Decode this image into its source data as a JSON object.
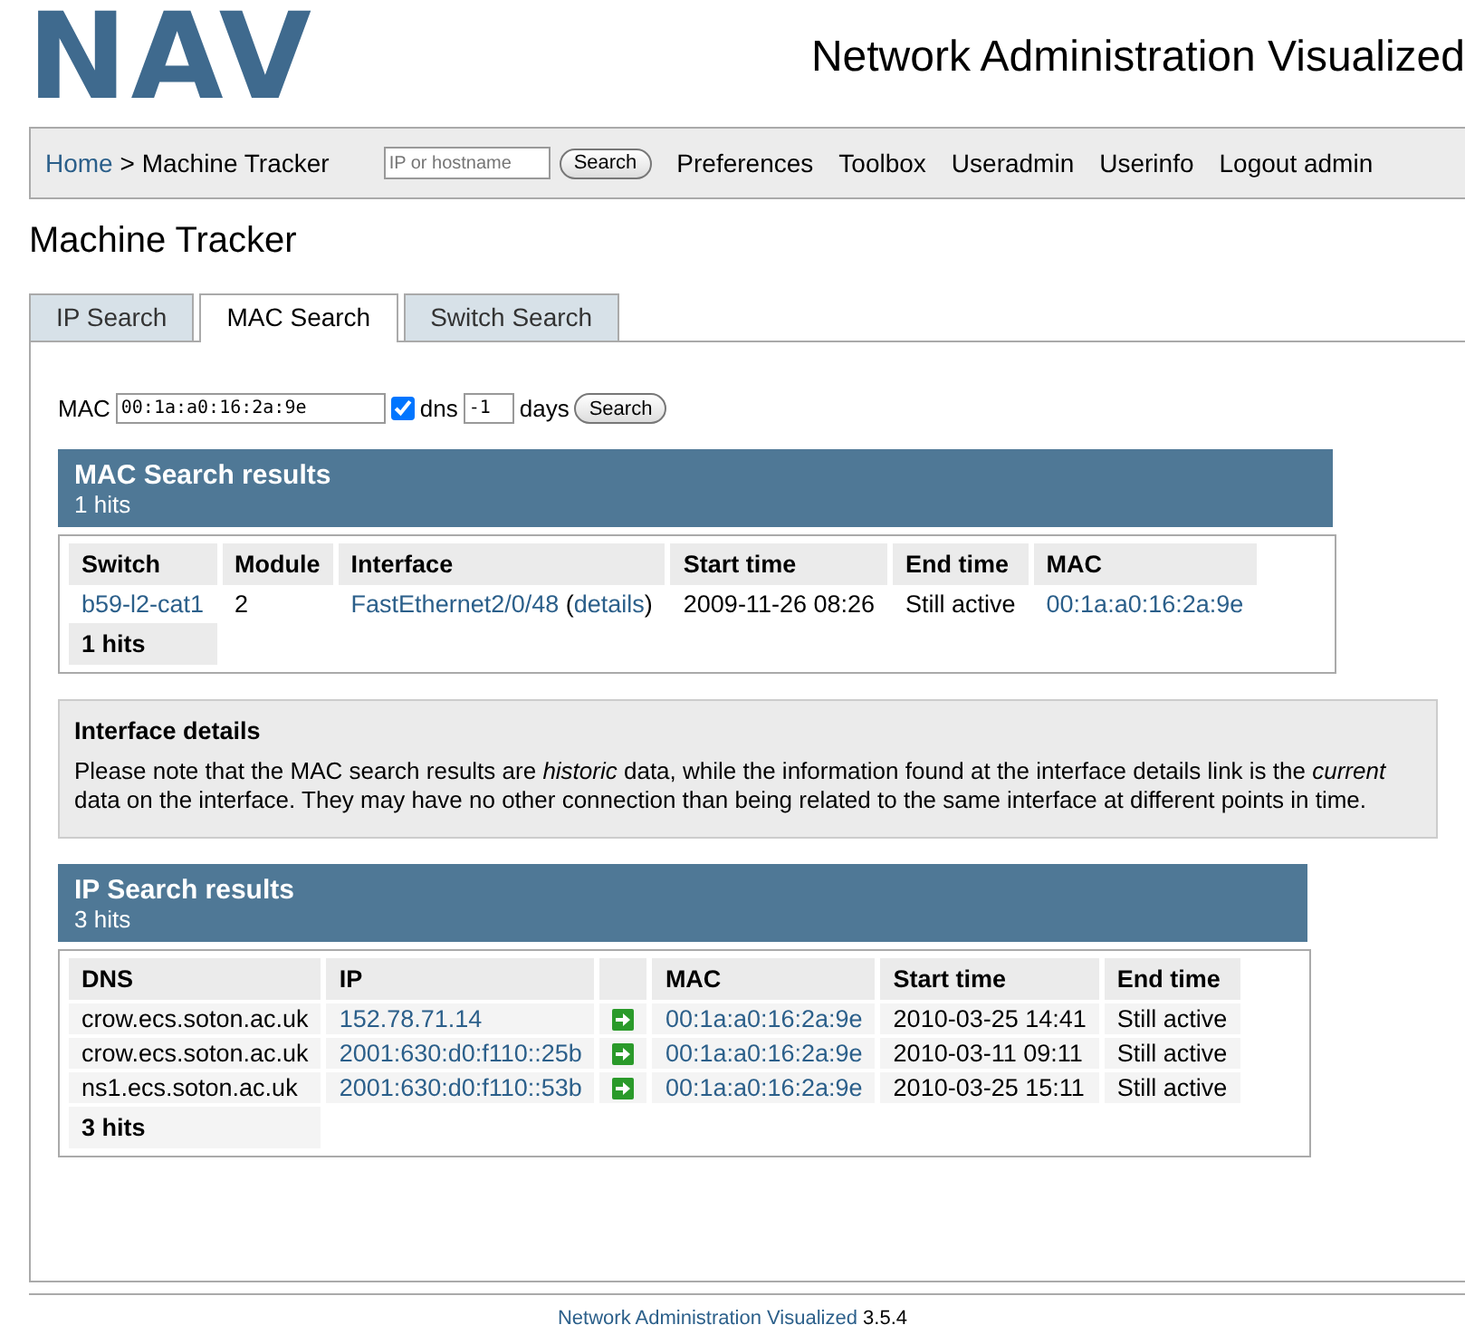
{
  "header": {
    "logo": "NAV",
    "title": "Network Administration Visualized"
  },
  "navbar": {
    "home": "Home",
    "separator": ">",
    "current": "Machine Tracker",
    "search": {
      "placeholder": "IP or hostname",
      "button": "Search"
    },
    "links": [
      "Preferences",
      "Toolbox",
      "Useradmin",
      "Userinfo",
      "Logout admin"
    ]
  },
  "page_title": "Machine Tracker",
  "tabs": [
    {
      "label": "IP Search",
      "selected": false
    },
    {
      "label": "MAC Search",
      "selected": true
    },
    {
      "label": "Switch Search",
      "selected": false
    }
  ],
  "form": {
    "label": "MAC",
    "value": "00:1a:a0:16:2a:9e",
    "dns_checked": true,
    "dns_label": "dns",
    "days_value": "-1",
    "days_label": "days",
    "button": "Search"
  },
  "mac_results": {
    "title": "MAC Search results",
    "hits": "1 hits",
    "columns": [
      {
        "label": "Switch"
      },
      {
        "label": "Module"
      },
      {
        "label": "Interface"
      },
      {
        "label": "Start time"
      },
      {
        "label": "End time"
      },
      {
        "label": "MAC"
      }
    ],
    "rows": [
      [
        {
          "text": "b59-l2-cat1",
          "link": true
        },
        {
          "text": "2",
          "link": false
        },
        {
          "segments": [
            {
              "text": "FastEthernet2/0/48",
              "link": true
            },
            {
              "text": " (",
              "link": false
            },
            {
              "text": "details",
              "link": true
            },
            {
              "text": ")",
              "link": false
            }
          ]
        },
        {
          "text": "2009-11-26 08:26",
          "link": false
        },
        {
          "text": "Still active",
          "link": false
        },
        {
          "text": "00:1a:a0:16:2a:9e",
          "link": true
        }
      ]
    ],
    "footer": "1 hits"
  },
  "note": {
    "title": "Interface details",
    "text": "Please note that the MAC search results are *historic* data, while the information found at the interface details link is the *current* data on the interface. They may have no other connection than being related to the same interface at different points in time."
  },
  "ip_results": {
    "title": "IP Search results",
    "hits": "3 hits",
    "columns": [
      {
        "label": "DNS"
      },
      {
        "label": "IP"
      },
      {
        "kind": "icon"
      },
      {
        "label": "MAC"
      },
      {
        "label": "Start time"
      },
      {
        "label": "End time"
      }
    ],
    "rows": [
      [
        {
          "text": "crow.ecs.soton.ac.uk",
          "link": false
        },
        {
          "text": "152.78.71.14",
          "link": true
        },
        {
          "kind": "icon"
        },
        {
          "text": "00:1a:a0:16:2a:9e",
          "link": true
        },
        {
          "text": "2010-03-25 14:41",
          "link": false
        },
        {
          "text": "Still active",
          "link": false
        }
      ],
      [
        {
          "text": "crow.ecs.soton.ac.uk",
          "link": false
        },
        {
          "text": "2001:630:d0:f110::25b",
          "link": true
        },
        {
          "kind": "icon"
        },
        {
          "text": "00:1a:a0:16:2a:9e",
          "link": true
        },
        {
          "text": "2010-03-11 09:11",
          "link": false
        },
        {
          "text": "Still active",
          "link": false
        }
      ],
      [
        {
          "text": "ns1.ecs.soton.ac.uk",
          "link": false
        },
        {
          "text": "2001:630:d0:f110::53b",
          "link": true
        },
        {
          "kind": "icon"
        },
        {
          "text": "00:1a:a0:16:2a:9e",
          "link": true
        },
        {
          "text": "2010-03-25 15:11",
          "link": false
        },
        {
          "text": "Still active",
          "link": false
        }
      ]
    ],
    "footer": "3 hits"
  },
  "footer": {
    "link": "Network Administration Visualized",
    "version": "3.5.4"
  }
}
